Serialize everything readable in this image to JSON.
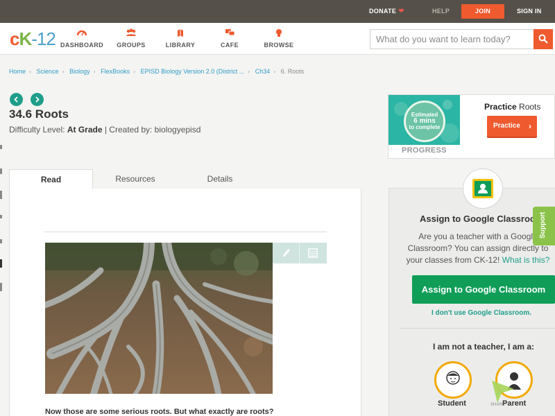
{
  "topbar": {
    "donate": "DONATE",
    "help": "HELP",
    "join": "JOIN",
    "signin": "SIGN IN",
    "heart_icon": "heart-icon"
  },
  "logo": {
    "c": "c",
    "k": "K",
    "n": "-12"
  },
  "nav": {
    "dashboard": "DASHBOARD",
    "groups": "GROUPS",
    "library": "LIBRARY",
    "cafe": "CAFE",
    "browse": "BROWSE"
  },
  "search": {
    "placeholder": "What do you want to learn today?"
  },
  "breadcrumb": {
    "items": [
      "Home",
      "Science",
      "Biology",
      "FlexBooks",
      "EPISD Biology Version 2.0 (District ...",
      "Ch34"
    ],
    "current": "6. Roots"
  },
  "page": {
    "title": "34.6 Roots",
    "difficulty_label": "Difficulty Level:",
    "difficulty_value": "At Grade",
    "created_by": "| Created by: biologyepisd"
  },
  "tabs": {
    "read": "Read",
    "resources": "Resources",
    "details": "Details"
  },
  "content": {
    "body_text": "Now those are some serious roots. But what exactly are roots?"
  },
  "practice": {
    "estimated_line1": "Estimated",
    "estimated_line2": "6 mins",
    "estimated_line3": "to complete",
    "progress_label": "PROGRESS",
    "title_bold": "Practice",
    "title_rest": "Roots",
    "button_label": "Practice"
  },
  "classroom": {
    "title": "Assign to Google Classroom",
    "text": "Are you a teacher with a Google Classroom? You can assign directly to your classes from CK-12!",
    "what_link": "What is this?",
    "button_label": "Assign to Google Classroom",
    "no_link": "I don't use Google Classroom.",
    "teacher_question": "I am not a teacher, I am a:",
    "student_label": "Student",
    "parent_label": "Parent",
    "share_label": "SHARE"
  },
  "support": {
    "label": "Support"
  },
  "colors": {
    "accent_orange": "#ef5a2e",
    "teal": "#1e9e8a",
    "google_green": "#0f9d58",
    "support_green": "#8bc34a"
  }
}
